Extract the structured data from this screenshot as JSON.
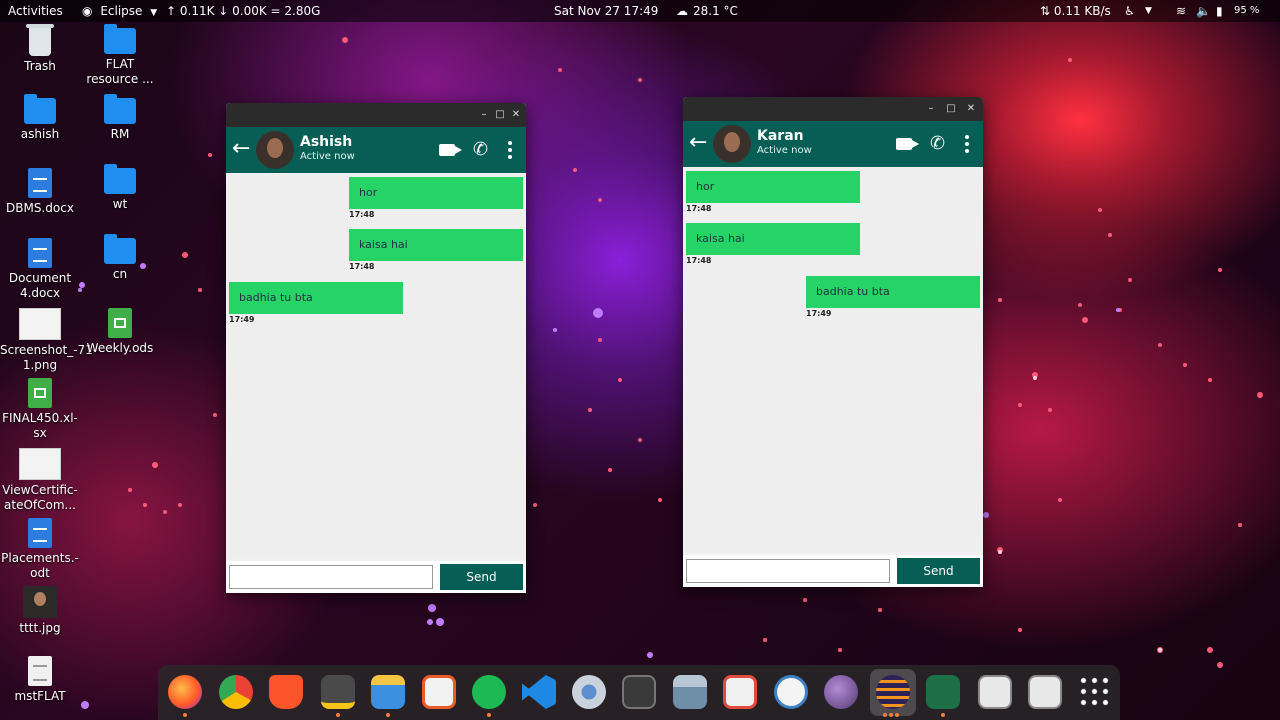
{
  "topbar": {
    "activities": "Activities",
    "app_menu": "Eclipse",
    "netspeed": "↑ 0.11K ↓ 0.00K = 2.80G",
    "clock": "Sat Nov 27  17:49",
    "weather": "28.1 °C",
    "net_rate": "⇅ 0.11 KB/s",
    "battery": "95 %"
  },
  "desktop": {
    "trash": "Trash",
    "flat": "FLAT resource ...",
    "ashish": "ashish",
    "rm": "RM",
    "dbms": "DBMS.docx",
    "wt": "wt",
    "document4": "Document 4.docx",
    "cn": "cn",
    "screenshot": "Screenshot_-71-1.png",
    "weekly": "Weekly.ods",
    "final450": "FINAL450.xl-sx",
    "certificate": "ViewCertific-ateOfCom...",
    "placements": "Placements.-odt",
    "tttt": "tttt.jpg",
    "mstflat": "mstFLAT"
  },
  "window_ashish": {
    "contact_name": "Ashish",
    "status": "Active now",
    "messages": [
      {
        "text": "hor",
        "time": "17:48",
        "side": "right"
      },
      {
        "text": "kaisa hai",
        "time": "17:48",
        "side": "right"
      },
      {
        "text": "badhia tu bta",
        "time": "17:49",
        "side": "left"
      }
    ],
    "input_value": "",
    "send_label": "Send"
  },
  "window_karan": {
    "contact_name": "Karan",
    "status": "Active now",
    "messages": [
      {
        "text": "hor",
        "time": "17:48",
        "side": "left"
      },
      {
        "text": "kaisa hai",
        "time": "17:48",
        "side": "left"
      },
      {
        "text": "badhia tu bta",
        "time": "17:49",
        "side": "right"
      }
    ],
    "input_value": "",
    "send_label": "Send"
  },
  "colors": {
    "chat_header": "#075e54",
    "bubble": "#25d366",
    "dock": "#282828"
  },
  "dock_icons": [
    "firefox-icon",
    "chrome-icon",
    "brave-icon",
    "notes-icon",
    "files-icon",
    "software-store-icon",
    "spotify-icon",
    "vscode-icon",
    "settings-icon",
    "terminal-icon",
    "calculator-icon",
    "screenshot-tool-icon",
    "android-studio-icon",
    "bug-icon",
    "eclipse-icon",
    "excel-icon",
    "drive-icon",
    "drive-icon",
    "app-grid-icon"
  ]
}
